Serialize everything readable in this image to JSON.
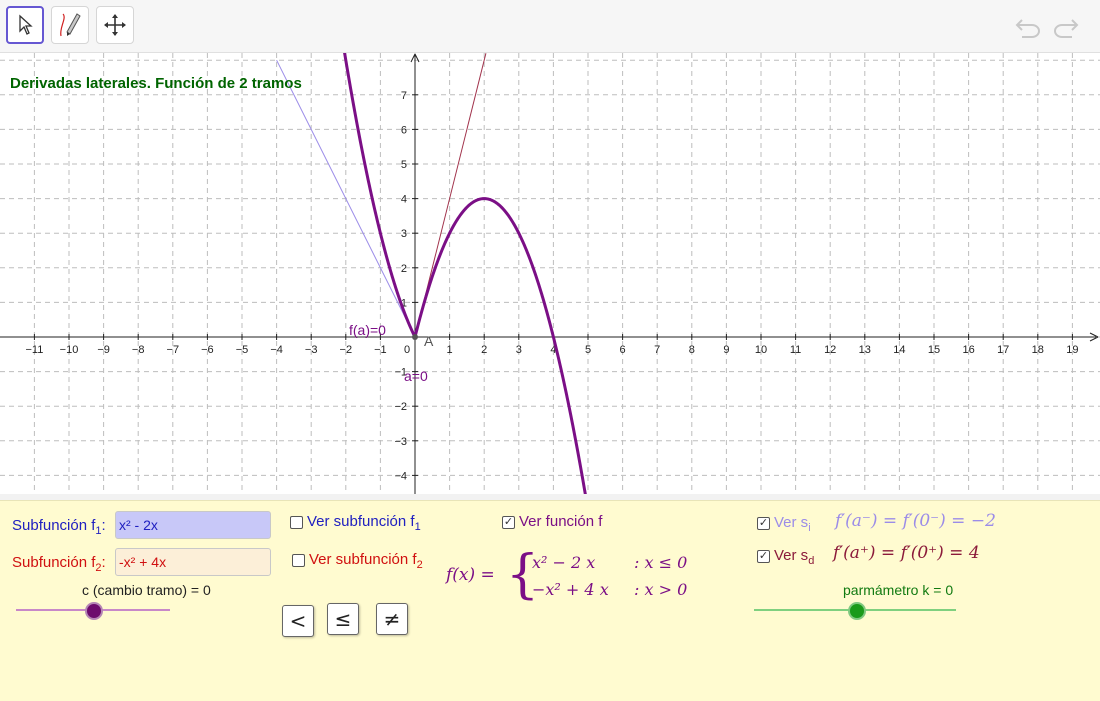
{
  "toolbar": {
    "tools": [
      "select-tool",
      "pen-tool",
      "move-graphics-tool"
    ]
  },
  "graph": {
    "title": "Derivadas laterales. Función de 2 tramos",
    "x_ticks": [
      "−11",
      "−10",
      "−9",
      "−8",
      "−7",
      "−6",
      "−5",
      "−4",
      "−3",
      "−2",
      "−1",
      "0",
      "1",
      "2",
      "3",
      "4",
      "5",
      "6",
      "7",
      "8",
      "9",
      "10",
      "11",
      "12",
      "13",
      "14",
      "15",
      "16",
      "17",
      "18",
      "19"
    ],
    "y_ticks_pos": [
      "1",
      "2",
      "3",
      "4",
      "5",
      "6",
      "7"
    ],
    "y_ticks_neg": [
      "−1",
      "−2",
      "−3",
      "−4"
    ],
    "point_label": "A",
    "fa_label": "f(a)=0",
    "a_label": "a=0",
    "colors": {
      "curve": "#7b0f86",
      "tangent_left": "#9b8ce8",
      "tangent_right": "#a0304a",
      "title": "#006400"
    }
  },
  "panel": {
    "f1": {
      "label": "Subfunción f",
      "sub": "1",
      "sep": ":",
      "value": "x² - 2x"
    },
    "f2": {
      "label": "Subfunción f",
      "sub": "2",
      "sep": ":",
      "value": "-x² + 4x"
    },
    "slider_c": {
      "label": "c (cambio tramo) = 0",
      "value": 0
    },
    "ver_f1": {
      "label": "Ver subfunción f",
      "sub": "1",
      "checked": false
    },
    "ver_f2": {
      "label": "Ver subfunción f",
      "sub": "2",
      "checked": false
    },
    "ver_f": {
      "label": "Ver función f",
      "checked": true
    },
    "formula": {
      "lhs": "f(x) =",
      "case1": "x² − 2 x",
      "cond1": ": x ≤ 0",
      "case2": "−x² + 4 x",
      "cond2": ": x > 0"
    },
    "buttons": [
      "<",
      "≤",
      "≠"
    ],
    "ver_si": {
      "label": "Ver s",
      "sub": "i",
      "checked": true,
      "formula": "f′(a⁻) = f′(0⁻) = −2"
    },
    "ver_sd": {
      "label": "Ver s",
      "sub": "d",
      "checked": true,
      "formula": "f′(a⁺) = f′(0⁺) = 4"
    },
    "slider_k": {
      "label": "parmámetro k = 0",
      "value": 0
    }
  }
}
